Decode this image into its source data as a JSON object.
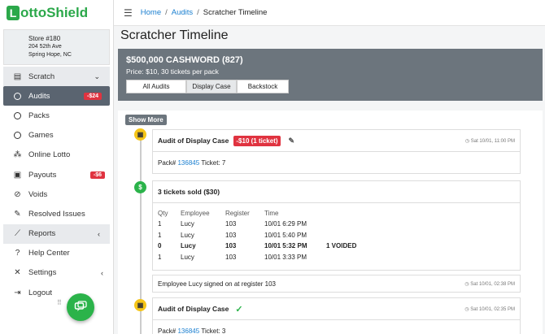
{
  "brand": {
    "logo_letter": "L",
    "logo_rest": "ottoShield",
    "color": "#2ba84a"
  },
  "store": {
    "name": "Store #180",
    "address1": "204 52th Ave",
    "address2": "Spring Hope, NC"
  },
  "sidebar": {
    "items": [
      {
        "label": "Scratch",
        "icon": "ticket-icon"
      },
      {
        "label": "Audits",
        "badge": "-$24",
        "icon": "circle-icon"
      },
      {
        "label": "Packs",
        "icon": "circle-icon"
      },
      {
        "label": "Games",
        "icon": "circle-icon"
      },
      {
        "label": "Online Lotto",
        "icon": "sitemap-icon"
      },
      {
        "label": "Payouts",
        "badge": "-$6",
        "icon": "money-icon"
      },
      {
        "label": "Voids",
        "icon": "ban-icon"
      },
      {
        "label": "Resolved Issues",
        "icon": "pencil-icon"
      },
      {
        "label": "Reports",
        "icon": "chart-icon"
      },
      {
        "label": "Help Center",
        "icon": "question-icon"
      },
      {
        "label": "Settings",
        "icon": "wrench-icon"
      },
      {
        "label": "Logout",
        "icon": "logout-icon"
      }
    ]
  },
  "breadcrumb": {
    "home": "Home",
    "audits": "Audits",
    "current": "Scratcher Timeline",
    "sep": "/"
  },
  "page": {
    "title": "Scratcher Timeline"
  },
  "hero": {
    "title": "$500,000 CASHWORD (827)",
    "price": "Price: $10, 30 tickets per pack",
    "tabs": [
      "All Audits",
      "Display Case",
      "Backstock"
    ],
    "selected_tab": "Display Case",
    "color": "#6c757d"
  },
  "timeline": {
    "show_more": "Show More",
    "audit1": {
      "title": "Audit of Display Case",
      "badge": "-$10 (1 ticket)",
      "timestamp": "Sat 10/01, 11:00 PM",
      "pack_label": "Pack#",
      "pack": "136845",
      "ticket": "Ticket: 7"
    },
    "sold": {
      "title": "3 tickets sold ($30)",
      "headers": [
        "Qty",
        "Employee",
        "Register",
        "Time"
      ],
      "rows": [
        {
          "qty": "1",
          "employee": "Lucy",
          "register": "103",
          "time": "10/01 6:29 PM",
          "note": ""
        },
        {
          "qty": "1",
          "employee": "Lucy",
          "register": "103",
          "time": "10/01 5:40 PM",
          "note": ""
        },
        {
          "qty": "0",
          "employee": "Lucy",
          "register": "103",
          "time": "10/01 5:32 PM",
          "note": "1 VOIDED"
        },
        {
          "qty": "1",
          "employee": "Lucy",
          "register": "103",
          "time": "10/01 3:33 PM",
          "note": ""
        }
      ]
    },
    "signon": {
      "text": "Employee Lucy signed on at register 103",
      "timestamp": "Sat 10/01, 02:38 PM"
    },
    "audit2": {
      "title": "Audit of Display Case",
      "timestamp": "Sat 10/01, 02:35 PM",
      "pack_label": "Pack#",
      "pack": "136845",
      "ticket": "Ticket: 3"
    }
  }
}
